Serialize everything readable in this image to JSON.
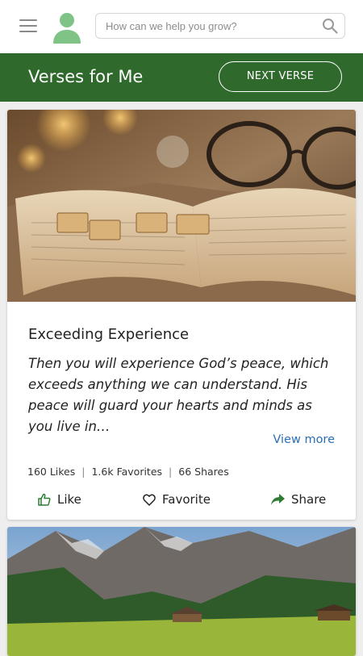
{
  "header": {
    "menu_icon": "hamburger-menu-icon",
    "avatar_icon": "user-avatar-icon",
    "search": {
      "placeholder": "How can we help you grow?",
      "icon": "search-icon"
    }
  },
  "banner": {
    "title": "Verses for Me",
    "next_button_label": "NEXT VERSE",
    "color": "#2f6a2c"
  },
  "card": {
    "title": "Exceeding Experience",
    "verse": "Then you will experience God’s peace, which exceeds anything we can understand. His peace will guard your hearts and minds as you live in…",
    "view_more": "View more",
    "stats": {
      "likes": "160 Likes",
      "favorites": "1.6k Favorites",
      "shares": "66 Shares",
      "separator": "|"
    },
    "actions": {
      "like": "Like",
      "favorite": "Favorite",
      "share": "Share"
    },
    "link_color": "#2a6eb3"
  }
}
